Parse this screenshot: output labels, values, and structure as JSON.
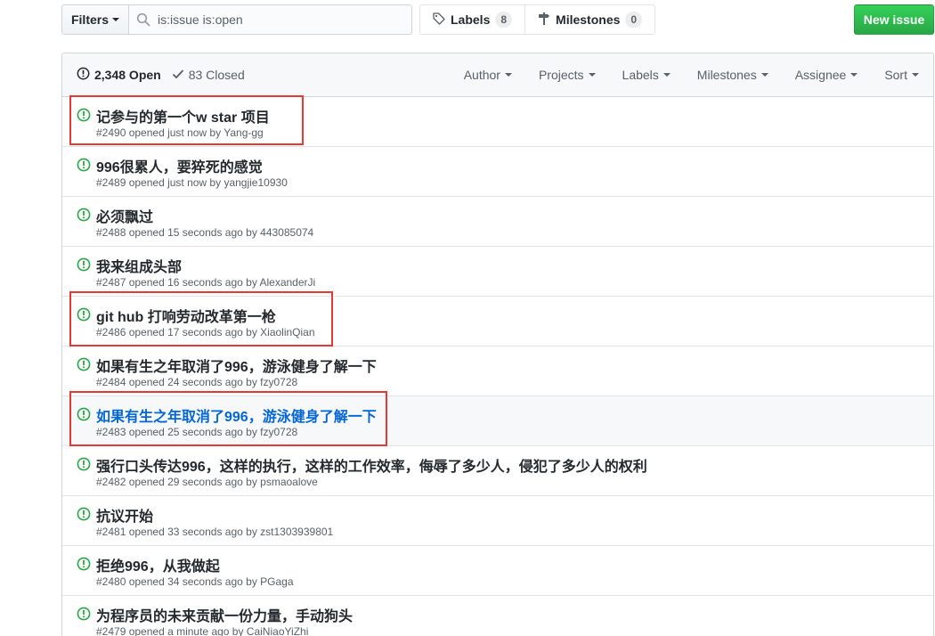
{
  "toolbar": {
    "filters_label": "Filters",
    "search_value": "is:issue is:open",
    "labels_label": "Labels",
    "labels_count": "8",
    "milestones_label": "Milestones",
    "milestones_count": "0",
    "new_issue_label": "New issue"
  },
  "header": {
    "open_label": "2,348 Open",
    "closed_label": "83 Closed",
    "filters": [
      "Author",
      "Projects",
      "Labels",
      "Milestones",
      "Assignee",
      "Sort"
    ]
  },
  "issues": [
    {
      "title": "记参与的第一个w star 项目",
      "meta": "#2490 opened just now by Yang-gg"
    },
    {
      "title": "996很累人，要猝死的感觉",
      "meta": "#2489 opened just now by yangjie10930"
    },
    {
      "title": "必须飘过",
      "meta": "#2488 opened 15 seconds ago by 443085074"
    },
    {
      "title": "我来组成头部",
      "meta": "#2487 opened 16 seconds ago by AlexanderJi"
    },
    {
      "title": "git hub 打响劳动改革第一枪",
      "meta": "#2486 opened 17 seconds ago by XiaolinQian"
    },
    {
      "title": "如果有生之年取消了996，游泳健身了解一下",
      "meta": "#2484 opened 24 seconds ago by fzy0728"
    },
    {
      "title": "如果有生之年取消了996，游泳健身了解一下",
      "meta": "#2483 opened 25 seconds ago by fzy0728"
    },
    {
      "title": "强行口头传达996，这样的执行，这样的工作效率，侮辱了多少人，侵犯了多少人的权利",
      "meta": "#2482 opened 29 seconds ago by psmaoalove"
    },
    {
      "title": "抗议开始",
      "meta": "#2481 opened 33 seconds ago by zst1303939801"
    },
    {
      "title": "拒绝996，从我做起",
      "meta": "#2480 opened 34 seconds ago by PGaga"
    },
    {
      "title": "为程序员的未来贡献一份力量，手动狗头",
      "meta": "#2479 opened a minute ago by CaiNiaoYiZhi"
    }
  ],
  "colors": {
    "open_icon": "#28a745",
    "link": "#0366d6",
    "annotation": "#e53935"
  }
}
